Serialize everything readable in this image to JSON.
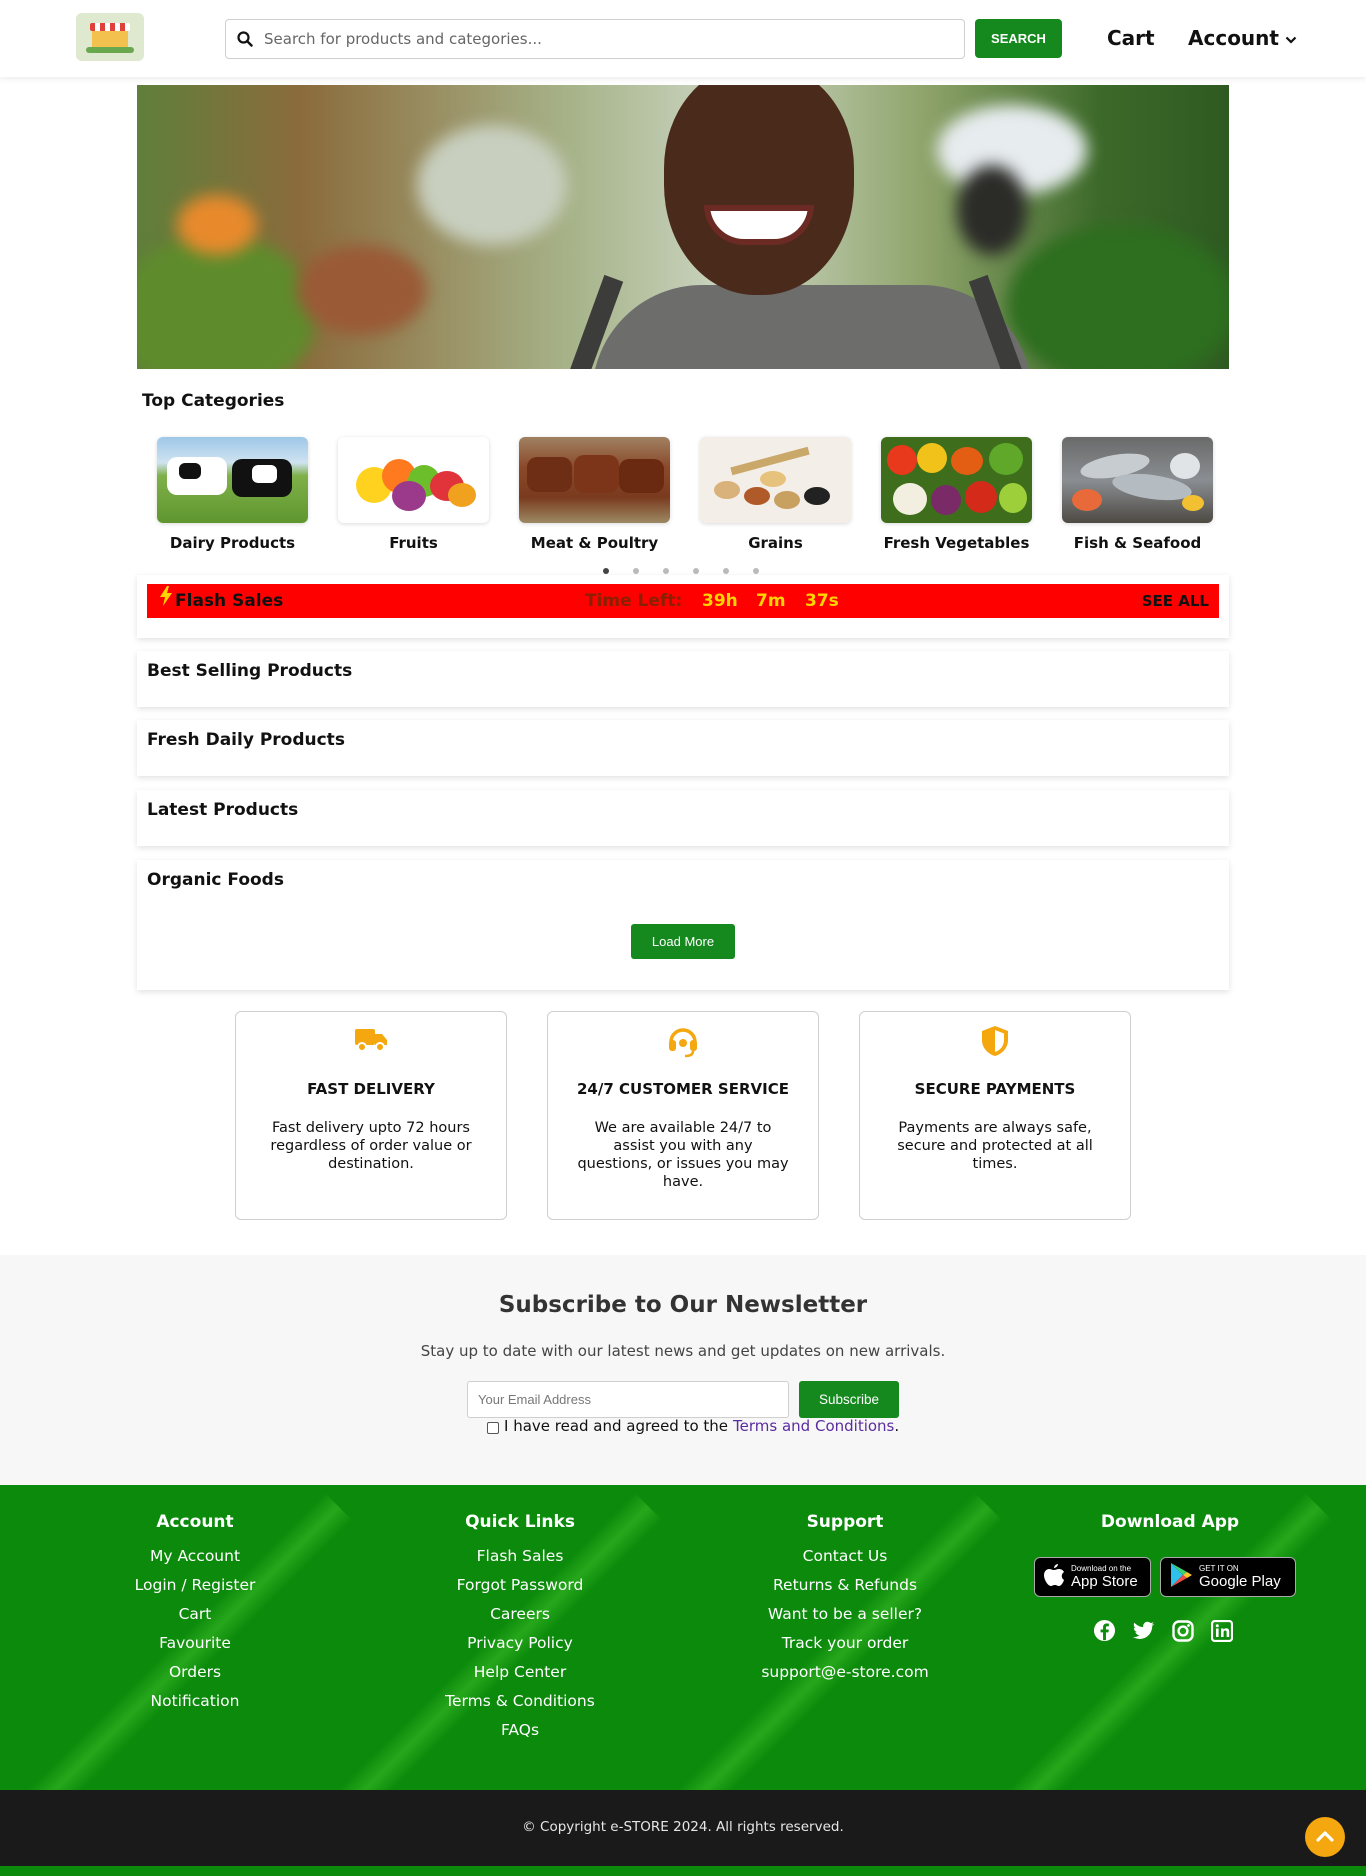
{
  "header": {
    "search_placeholder": "Search for products and categories...",
    "search_button": "SEARCH",
    "cart": "Cart",
    "account": "Account"
  },
  "top_categories": {
    "title": "Top Categories",
    "items": [
      {
        "label": "Dairy Products"
      },
      {
        "label": "Fruits"
      },
      {
        "label": "Meat & Poultry"
      },
      {
        "label": "Grains"
      },
      {
        "label": "Fresh Vegetables"
      },
      {
        "label": "Fish & Seafood"
      }
    ]
  },
  "flash_sales": {
    "label": "Flash Sales",
    "time_left_label": "Time Left:",
    "hours": "39h",
    "minutes": "7m",
    "seconds": "37s",
    "see_all": "SEE ALL"
  },
  "sections": {
    "best_selling": "Best Selling Products",
    "fresh_daily": "Fresh Daily Products",
    "latest": "Latest Products",
    "organic": "Organic Foods",
    "load_more": "Load More"
  },
  "features": [
    {
      "title": "FAST DELIVERY",
      "desc": "Fast delivery upto 72 hours regardless of order value or destination."
    },
    {
      "title": "24/7 CUSTOMER SERVICE",
      "desc": "We are available 24/7 to assist you with any questions, or issues you may have."
    },
    {
      "title": "SECURE PAYMENTS",
      "desc": "Payments are always safe, secure and protected at all times."
    }
  ],
  "newsletter": {
    "title": "Subscribe to Our Newsletter",
    "subtitle": "Stay up to date with our latest news and get updates on new arrivals.",
    "email_placeholder": "Your Email Address",
    "subscribe": "Subscribe",
    "terms_prefix": "I have read and agreed to the",
    "terms_link": "Terms and Conditions",
    "terms_suffix": "."
  },
  "footer": {
    "account": {
      "title": "Account",
      "links": [
        "My Account",
        "Login / Register",
        "Cart",
        "Favourite",
        "Orders",
        "Notification"
      ]
    },
    "quick_links": {
      "title": "Quick Links",
      "links": [
        "Flash Sales",
        "Forgot Password",
        "Careers",
        "Privacy Policy",
        "Help Center",
        "Terms & Conditions",
        "FAQs"
      ]
    },
    "support": {
      "title": "Support",
      "links": [
        "Contact Us",
        "Returns & Refunds",
        "Want to be a seller?",
        "Track your order",
        "support@e-store.com"
      ]
    },
    "download": {
      "title": "Download App",
      "app_store_small": "Download on the",
      "app_store_big": "App Store",
      "play_small": "GET IT ON",
      "play_big": "Google Play"
    }
  },
  "copyright": "© Copyright e-STORE 2024. All rights reserved.",
  "colors": {
    "brand_green": "#15891e",
    "footer_green": "#0b8a0b",
    "flash_red": "#ff0000",
    "accent_orange": "#f4a70e",
    "timer_yellow": "#ffd400"
  },
  "icons": {
    "search": "search-icon",
    "chevron": "chevron-down-icon",
    "flash": "lightning-icon",
    "delivery": "truck-icon",
    "support": "headset-icon",
    "secure": "shield-icon",
    "social": [
      "facebook-icon",
      "twitter-icon",
      "instagram-icon",
      "linkedin-icon"
    ],
    "scroll_top": "chevron-up-icon"
  }
}
